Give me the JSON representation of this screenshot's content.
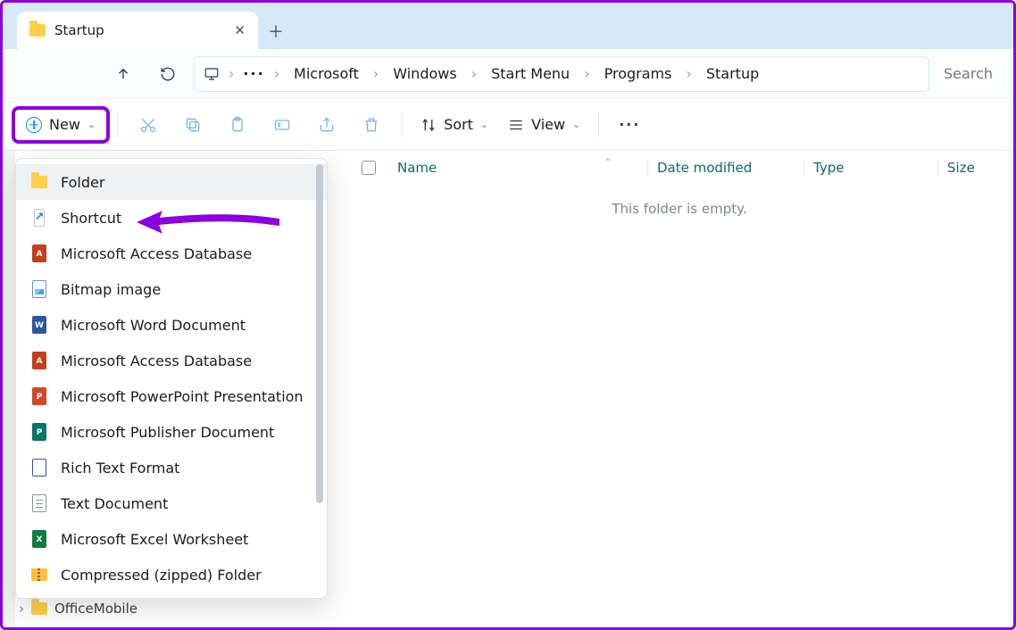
{
  "tab": {
    "title": "Startup"
  },
  "breadcrumbs": [
    "Microsoft",
    "Windows",
    "Start Menu",
    "Programs",
    "Startup"
  ],
  "search_placeholder": "Search",
  "toolbar": {
    "new_label": "New",
    "sort_label": "Sort",
    "view_label": "View"
  },
  "columns": {
    "name": "Name",
    "date": "Date modified",
    "type": "Type",
    "size": "Size"
  },
  "empty_text": "This folder is empty.",
  "new_menu": [
    {
      "label": "Folder",
      "icon": "folder"
    },
    {
      "label": "Shortcut",
      "icon": "shortcut"
    },
    {
      "label": "Microsoft Access Database",
      "icon": "access"
    },
    {
      "label": "Bitmap image",
      "icon": "bitmap"
    },
    {
      "label": "Microsoft Word Document",
      "icon": "word"
    },
    {
      "label": "Microsoft Access Database",
      "icon": "access"
    },
    {
      "label": "Microsoft PowerPoint Presentation",
      "icon": "ppt"
    },
    {
      "label": "Microsoft Publisher Document",
      "icon": "pub"
    },
    {
      "label": "Rich Text Format",
      "icon": "rtf"
    },
    {
      "label": "Text Document",
      "icon": "txt"
    },
    {
      "label": "Microsoft Excel Worksheet",
      "icon": "excel"
    },
    {
      "label": "Compressed (zipped) Folder",
      "icon": "zip"
    }
  ],
  "tree_item": "OfficeMobile",
  "annotation": {
    "highlight": "New button",
    "arrow_target": "Shortcut"
  }
}
